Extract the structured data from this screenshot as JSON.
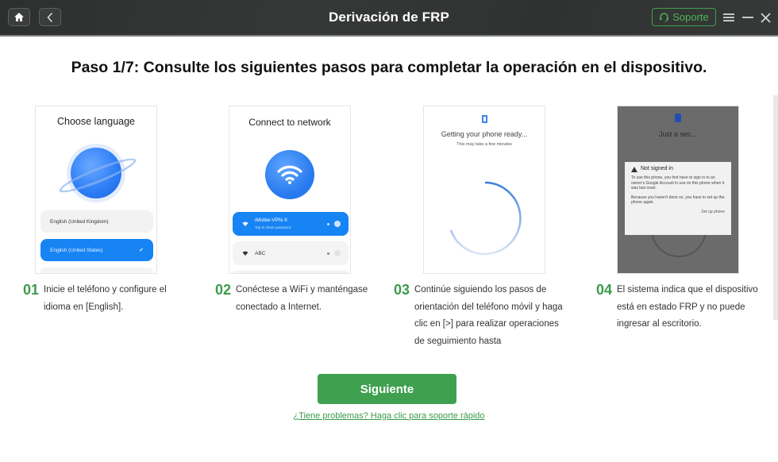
{
  "window": {
    "title": "Derivación de FRP",
    "support_label": "Soporte",
    "icons": {
      "home": "home-icon",
      "back": "chevron-left-icon",
      "support": "headset-icon",
      "menu": "hamburger-menu-icon",
      "minimize": "minimize-icon",
      "close": "close-icon"
    }
  },
  "heading": "Paso 1/7: Consulte los siguientes pasos para completar la operación en el dispositivo.",
  "steps": [
    {
      "number": "01",
      "text": "Inicie el teléfono y configure el idioma en [English].",
      "screen": {
        "title": "Choose language",
        "options": [
          "English (United Kingdom)",
          "English (United States)"
        ],
        "selected": "English (United States)",
        "check": "✔"
      }
    },
    {
      "number": "02",
      "text": "Conéctese a WiFi y manténgase conectado a Internet.",
      "screen": {
        "title": "Connect to network",
        "networks": [
          {
            "name": "iMobie-VPN-X",
            "subtitle": "Tap to share password"
          },
          {
            "name": "ABC",
            "subtitle": ""
          }
        ]
      }
    },
    {
      "number": "03",
      "text": "Continúe siguiendo los pasos de orientación del teléfono móvil y haga clic en [>] para realizar operaciones de seguimiento hasta",
      "screen": {
        "title": "Getting your phone ready...",
        "subtitle": "This may take a few minutes"
      }
    },
    {
      "number": "04",
      "text": "El sistema indica que el dispositivo está en estado FRP y no puede ingresar al escritorio.",
      "screen": {
        "title": "Just a sec...",
        "dialog_title": "Not signed in",
        "dialog_p1": "To use this phone, you first have to sign in to an owner's Google Account in use on this phone when it was last reset.",
        "dialog_p2": "Because you haven't done so, you have to set up the phone again.",
        "dialog_action": "Set up phone"
      }
    }
  ],
  "actions": {
    "next_label": "Siguiente",
    "help_link": "¿Tiene problemas? Haga clic para soporte rápido"
  },
  "colors": {
    "accent_green": "#3fa04f",
    "titlebar": "#323533",
    "phone_blue": "#1784f4"
  }
}
